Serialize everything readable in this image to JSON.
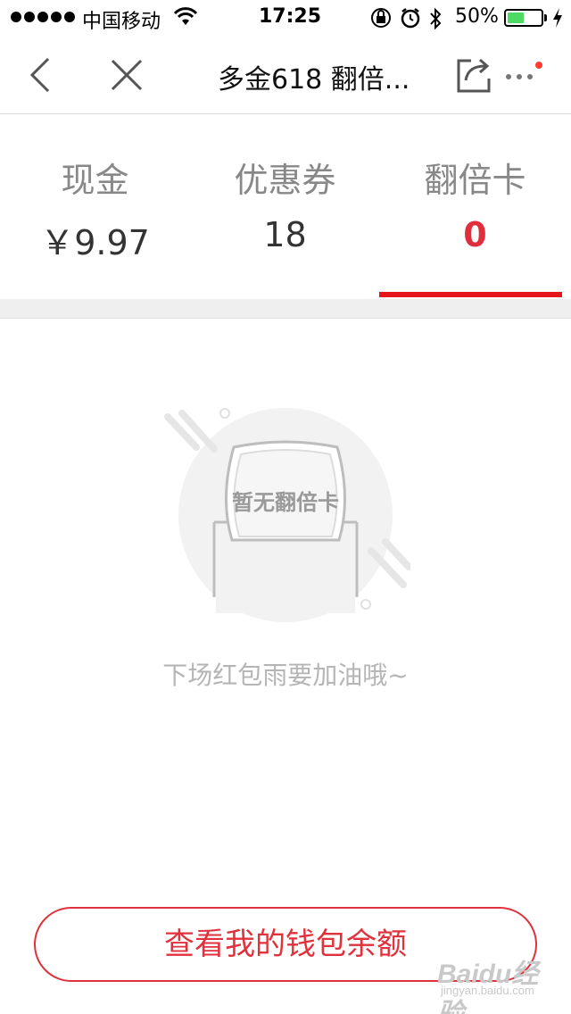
{
  "status_bar": {
    "carrier": "中国移动",
    "time": "17:25",
    "battery_percent": "50%",
    "battery_level": 0.5,
    "icons": [
      "signal-dots",
      "wifi-icon",
      "rotation-lock-icon",
      "alarm-icon",
      "bluetooth-icon",
      "battery-icon",
      "charging-bolt-icon"
    ]
  },
  "nav": {
    "title": "多金618 翻倍...",
    "icons": [
      "back-icon",
      "close-icon",
      "share-icon",
      "more-icon"
    ],
    "notification_dot_color": "#ff3b30"
  },
  "tabs": [
    {
      "label": "现金",
      "value": "￥9.97"
    },
    {
      "label": "优惠券",
      "value": "18"
    },
    {
      "label": "翻倍卡",
      "value": "0",
      "active": true
    }
  ],
  "empty_state": {
    "badge_text": "暂无翻倍卡",
    "message": "下场红包雨要加油哦~"
  },
  "wallet_button": {
    "label": "查看我的钱包余额"
  },
  "watermark": {
    "logo": "Baidu经验",
    "url": "jingyan.baidu.com"
  },
  "colors": {
    "accent": "#e0313c",
    "indicator": "#e4151b",
    "muted_text": "#888888",
    "separator": "#efefef"
  }
}
